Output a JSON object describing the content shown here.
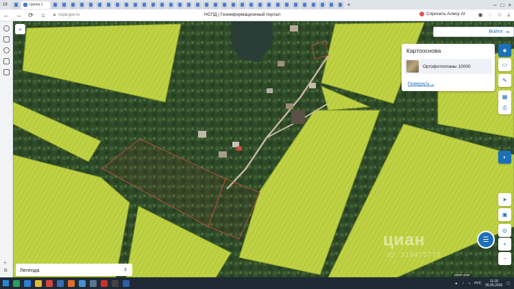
{
  "browser": {
    "tab_count": "18",
    "active_tab_title": "группа 1",
    "url": "nspd.gov.ru",
    "page_title": "НСПД | Геоинформационный портал",
    "alice_label": "Спросить Алису AI"
  },
  "map": {
    "login_label": "Войти",
    "basemap_panel": {
      "title": "Картооснова",
      "layer_label": "Ортофотопланы 10000",
      "expand_label": "Развернуть"
    },
    "legend_label": "Легенда",
    "watermark_text": "циан",
    "watermark_id": "ID: 319475778",
    "scale_text": "10000 2026"
  },
  "taskbar": {
    "language": "РУС",
    "time": "11:18",
    "date": "05.05.2026"
  },
  "colors": {
    "accent": "#1d6fb8",
    "field": "#c9d64a",
    "parcel_outline": "#b5523a"
  }
}
